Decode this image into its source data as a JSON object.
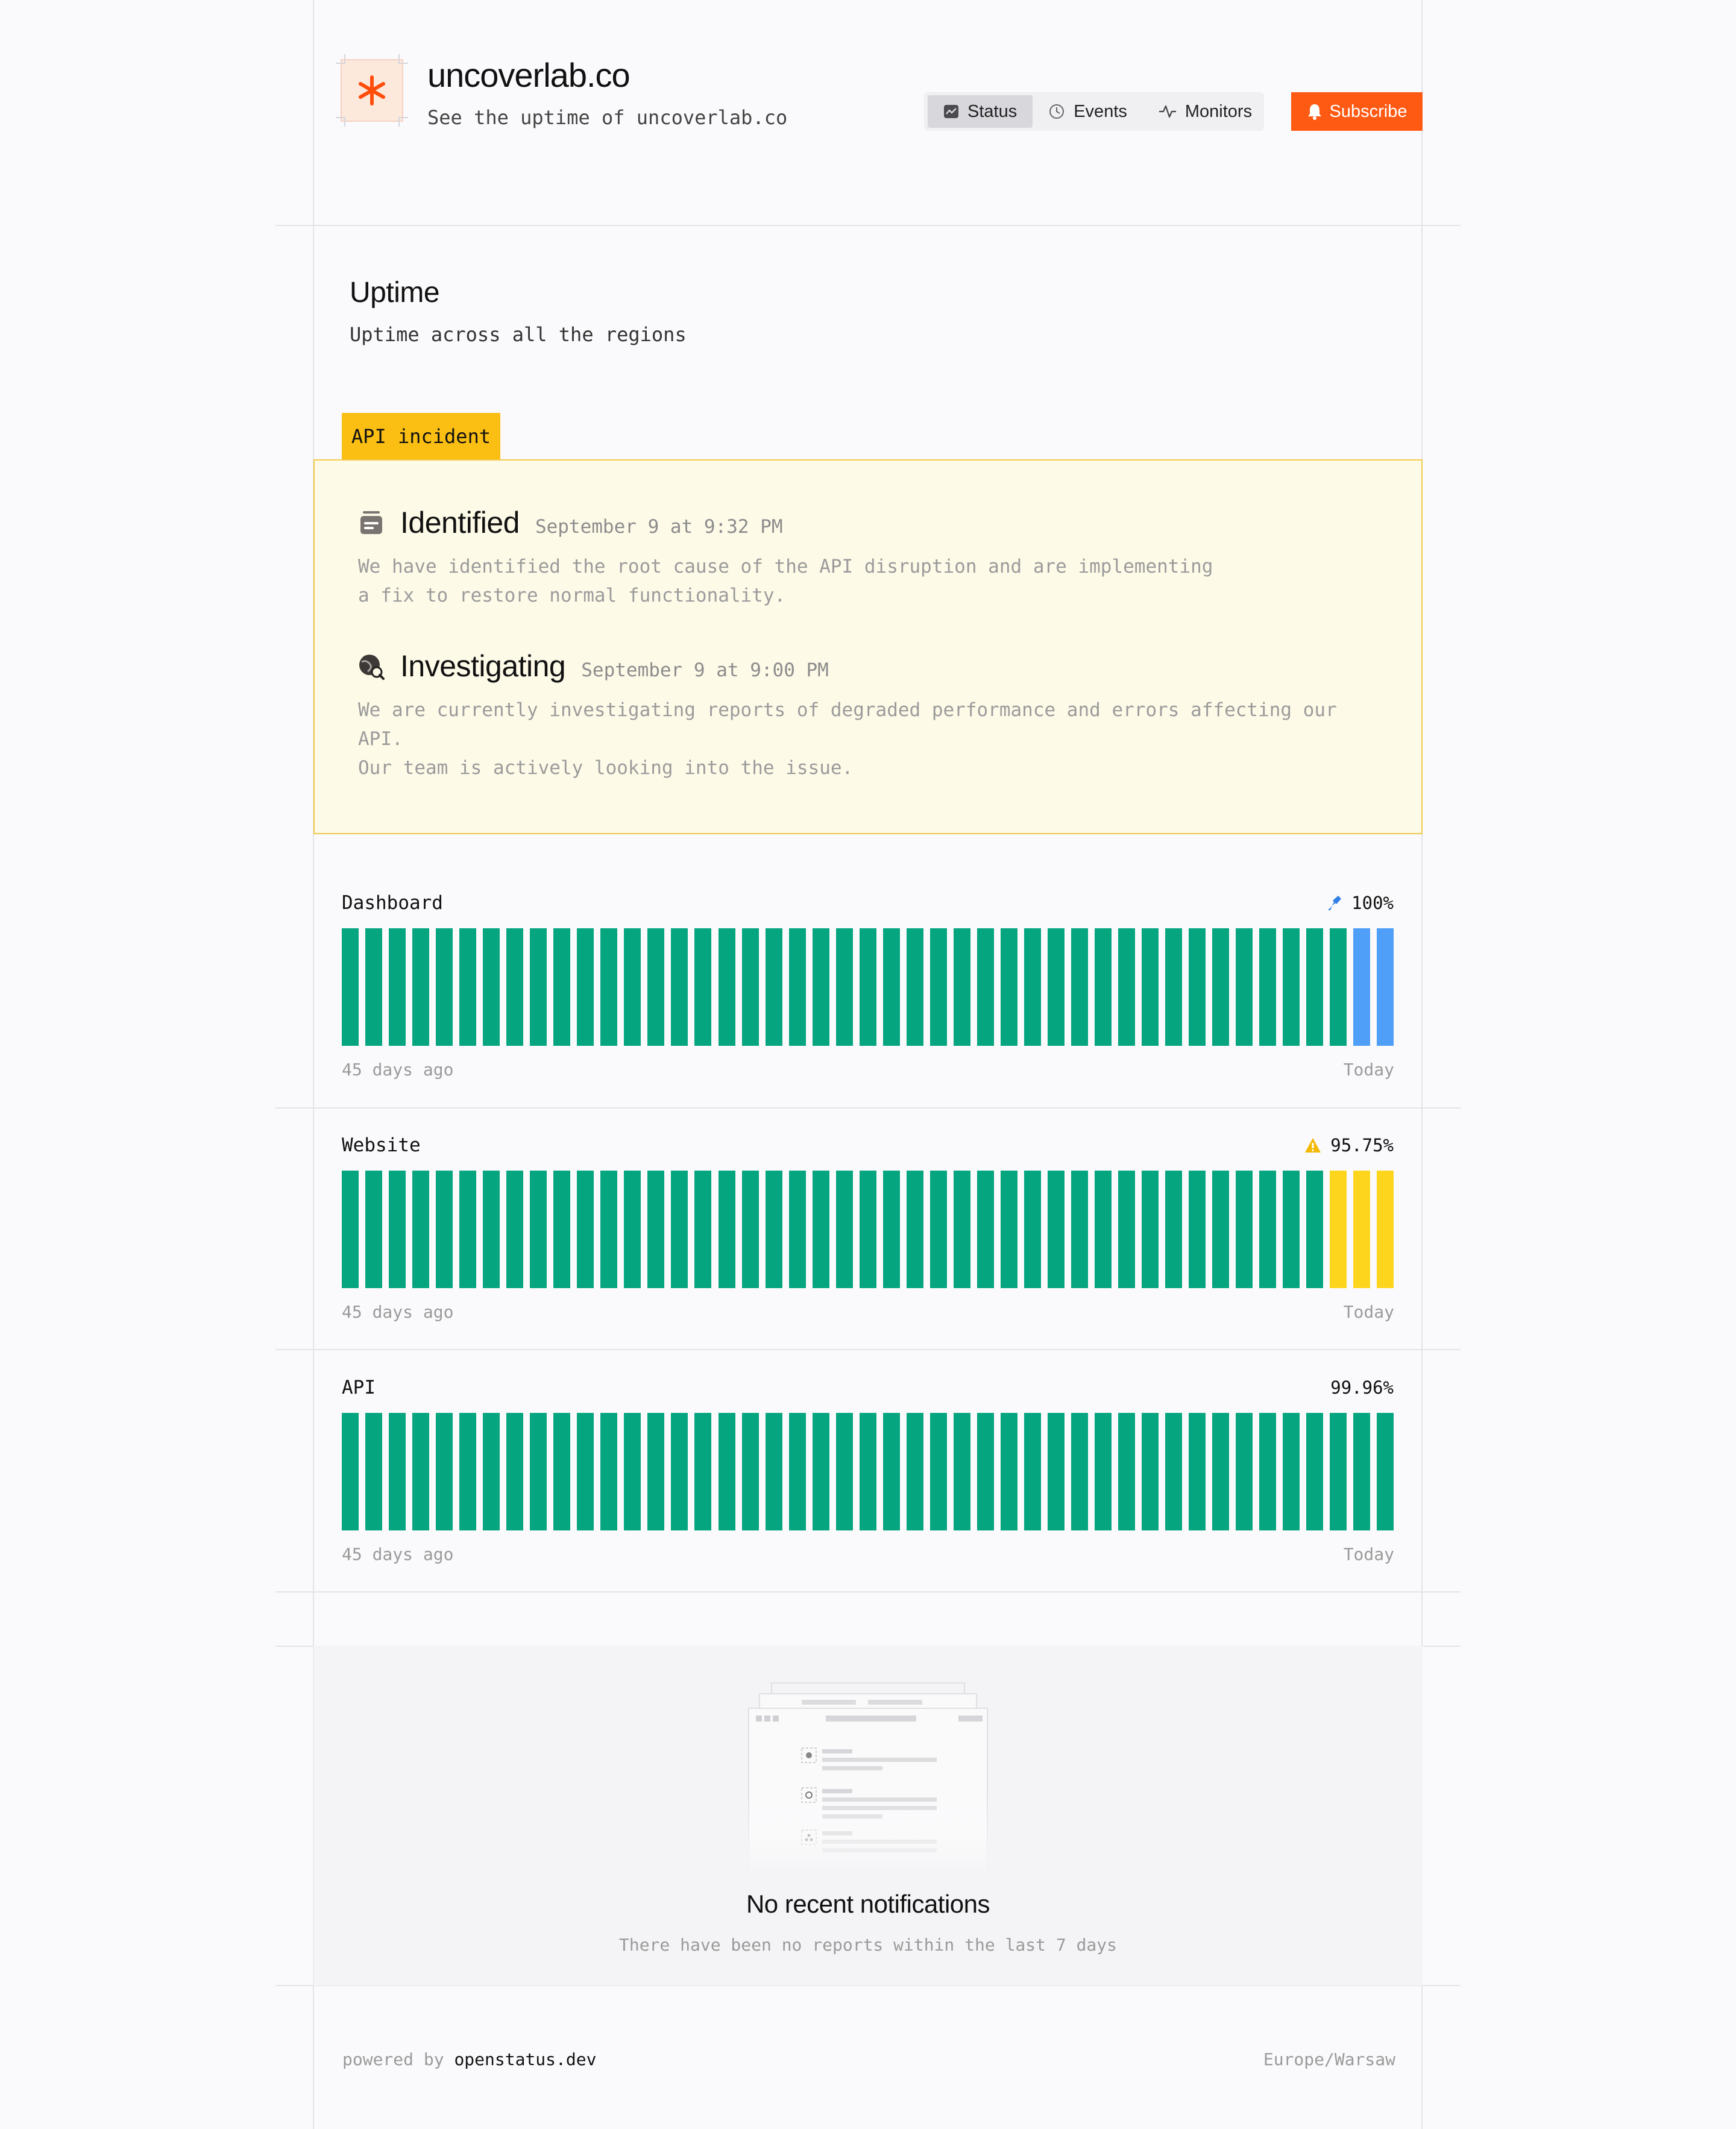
{
  "header": {
    "title": "uncoverlab.co",
    "subtitle": "See the uptime of uncoverlab.co",
    "logo_icon": "asterisk-icon"
  },
  "nav": {
    "items": [
      {
        "label": "Status",
        "icon": "chart-icon",
        "active": true
      },
      {
        "label": "Events",
        "icon": "clock-icon",
        "active": false
      },
      {
        "label": "Monitors",
        "icon": "activity-icon",
        "active": false
      }
    ],
    "subscribe_label": "Subscribe"
  },
  "uptime": {
    "title": "Uptime",
    "subtitle": "Uptime across all the regions"
  },
  "incident": {
    "tag": "API incident",
    "updates": [
      {
        "status": "Identified",
        "date": "September 9 at 9:32 PM",
        "message": "We have identified the root cause of the API disruption and are implementing\na fix to restore normal functionality."
      },
      {
        "status": "Investigating",
        "date": "September 9 at 9:00 PM",
        "message": "We are currently investigating reports of degraded performance and errors affecting our\nAPI.\nOur team is actively looking into the issue."
      }
    ]
  },
  "monitors": [
    {
      "name": "Dashboard",
      "uptime": "100%",
      "status_icon": "maintenance-icon",
      "from": "45 days ago",
      "to": "Today",
      "bars": [
        "ok",
        "ok",
        "ok",
        "ok",
        "ok",
        "ok",
        "ok",
        "ok",
        "ok",
        "ok",
        "ok",
        "ok",
        "ok",
        "ok",
        "ok",
        "ok",
        "ok",
        "ok",
        "ok",
        "ok",
        "ok",
        "ok",
        "ok",
        "ok",
        "ok",
        "ok",
        "ok",
        "ok",
        "ok",
        "ok",
        "ok",
        "ok",
        "ok",
        "ok",
        "ok",
        "ok",
        "ok",
        "ok",
        "ok",
        "ok",
        "ok",
        "ok",
        "ok",
        "maint",
        "maint"
      ]
    },
    {
      "name": "Website",
      "uptime": "95.75%",
      "status_icon": "warning-icon",
      "from": "45 days ago",
      "to": "Today",
      "bars": [
        "ok",
        "ok",
        "ok",
        "ok",
        "ok",
        "ok",
        "ok",
        "ok",
        "ok",
        "ok",
        "ok",
        "ok",
        "ok",
        "ok",
        "ok",
        "ok",
        "ok",
        "ok",
        "ok",
        "ok",
        "ok",
        "ok",
        "ok",
        "ok",
        "ok",
        "ok",
        "ok",
        "ok",
        "ok",
        "ok",
        "ok",
        "ok",
        "ok",
        "ok",
        "ok",
        "ok",
        "ok",
        "ok",
        "ok",
        "ok",
        "ok",
        "ok",
        "degraded",
        "degraded",
        "degraded"
      ]
    },
    {
      "name": "API",
      "uptime": "99.96%",
      "status_icon": "",
      "from": "45 days ago",
      "to": "Today",
      "bars": [
        "ok",
        "ok",
        "ok",
        "ok",
        "ok",
        "ok",
        "ok",
        "ok",
        "ok",
        "ok",
        "ok",
        "ok",
        "ok",
        "ok",
        "ok",
        "ok",
        "ok",
        "ok",
        "ok",
        "ok",
        "ok",
        "ok",
        "ok",
        "ok",
        "ok",
        "ok",
        "ok",
        "ok",
        "ok",
        "ok",
        "ok",
        "ok",
        "ok",
        "ok",
        "ok",
        "ok",
        "ok",
        "ok",
        "ok",
        "ok",
        "ok",
        "ok",
        "ok",
        "ok",
        "ok"
      ]
    }
  ],
  "colors": {
    "ok": "#05a57f",
    "maint": "#4f9ef7",
    "degraded": "#fed51d",
    "accent": "#ff5a14",
    "incident_tag": "#fbbf14"
  },
  "notifications": {
    "title": "No recent notifications",
    "subtitle": "There have been no reports within the last 7 days"
  },
  "footer": {
    "powered_prefix": "powered by",
    "powered_link": "openstatus.dev",
    "timezone": "Europe/Warsaw"
  }
}
